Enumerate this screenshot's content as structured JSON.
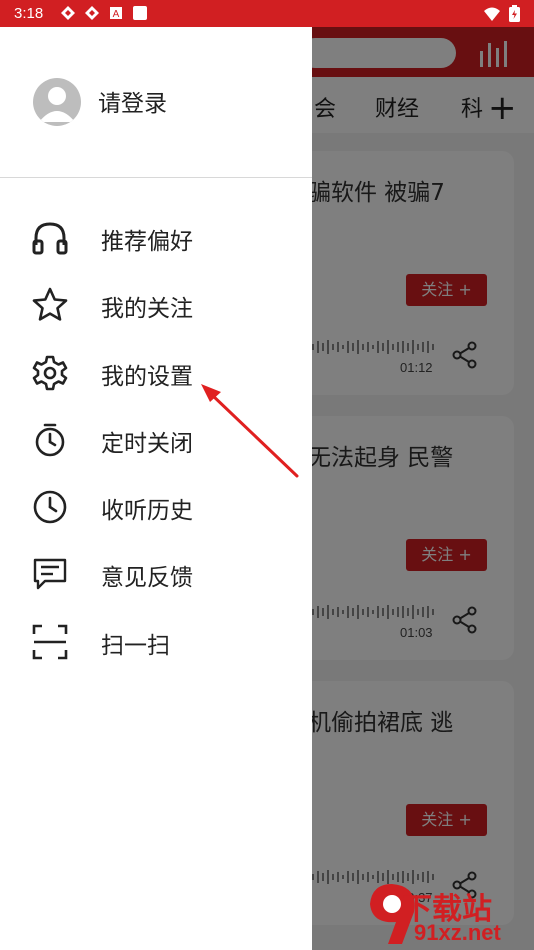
{
  "status_bar": {
    "time": "3:18",
    "icons": [
      "notification-icon",
      "notification-icon",
      "text-a-icon",
      "square-icon"
    ],
    "right_icons": [
      "wifi-icon",
      "battery-icon"
    ]
  },
  "drawer": {
    "login_label": "请登录",
    "menu": [
      {
        "label": "推荐偏好",
        "icon": "headphones-icon"
      },
      {
        "label": "我的关注",
        "icon": "star-icon"
      },
      {
        "label": "我的设置",
        "icon": "gear-icon"
      },
      {
        "label": "定时关闭",
        "icon": "timer-icon"
      },
      {
        "label": "收听历史",
        "icon": "clock-icon"
      },
      {
        "label": "意见反馈",
        "icon": "feedback-icon"
      },
      {
        "label": "扫一扫",
        "icon": "scan-icon"
      }
    ]
  },
  "background": {
    "tabs": [
      "会",
      "财经",
      "科"
    ],
    "cards": [
      {
        "title": "骗软件 被骗7",
        "follow": "关注 +",
        "duration": "01:12"
      },
      {
        "title": "无法起身 民警",
        "follow": "关注 +",
        "duration": "01:03"
      },
      {
        "title": "机偷拍裙底 逃",
        "follow": "关注 +",
        "duration": "00:37"
      }
    ]
  },
  "watermark": {
    "line1": "下载站",
    "line2": "91xz.net"
  },
  "colors": {
    "accent": "#d11f22",
    "drawer_bg": "#ffffff",
    "text": "#222222"
  }
}
